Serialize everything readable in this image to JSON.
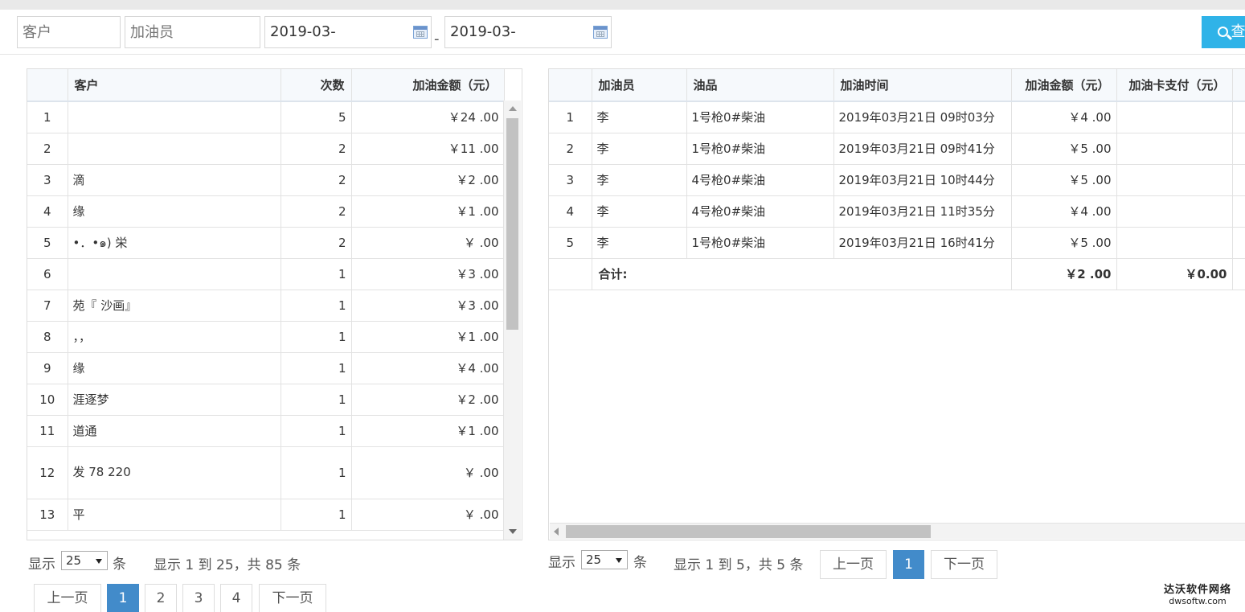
{
  "filters": {
    "customer_placeholder": "客户",
    "attendant_placeholder": "加油员",
    "date_from": "2019-03-",
    "date_to": "2019-03-",
    "separator": "-",
    "search_label": "查"
  },
  "left_table": {
    "columns": [
      "",
      "客户",
      "次数",
      "加油金额（元）"
    ],
    "rows": [
      {
        "index": "1",
        "customer": "",
        "count": "5",
        "amount": "￥24  .00"
      },
      {
        "index": "2",
        "customer": "",
        "count": "2",
        "amount": "￥11  .00"
      },
      {
        "index": "3",
        "customer": "滴",
        "count": "2",
        "amount": "￥2  .00"
      },
      {
        "index": "4",
        "customer": "缘",
        "count": "2",
        "amount": "￥1  .00"
      },
      {
        "index": "5",
        "customer": "•．•๑) 栄",
        "count": "2",
        "amount": "￥  .00"
      },
      {
        "index": "6",
        "customer": "",
        "count": "1",
        "amount": "￥3  .00"
      },
      {
        "index": "7",
        "customer": "苑『  沙画』",
        "count": "1",
        "amount": "￥3  .00"
      },
      {
        "index": "8",
        "customer": "，，",
        "count": "1",
        "amount": "￥1  .00"
      },
      {
        "index": "9",
        "customer": "缘",
        "count": "1",
        "amount": "￥4  .00"
      },
      {
        "index": "10",
        "customer": "涯逐梦",
        "count": "1",
        "amount": "￥2  .00"
      },
      {
        "index": "11",
        "customer": "道通",
        "count": "1",
        "amount": "￥1  .00"
      },
      {
        "index": "12",
        "customer": "发  78 220",
        "count": "1",
        "amount": "￥  .00"
      },
      {
        "index": "13",
        "customer": "平",
        "count": "1",
        "amount": "￥  .00"
      }
    ],
    "show_label": "显示",
    "page_size": "25",
    "unit_label": "条",
    "summary": "显示 1 到 25，共 85 条",
    "pages": [
      "上一页",
      "1",
      "2",
      "3",
      "4",
      "下一页"
    ],
    "active_page": "1"
  },
  "right_table": {
    "columns": [
      "",
      "加油员",
      "油品",
      "加油时间",
      "加油金额（元）",
      "加油卡支付（元）"
    ],
    "rows": [
      {
        "index": "1",
        "attendant": "李  ",
        "product": "1号枪0#柴油",
        "time": "2019年03月21日 09时03分",
        "amount": "￥4  .00",
        "card": ""
      },
      {
        "index": "2",
        "attendant": "李  ",
        "product": "1号枪0#柴油",
        "time": "2019年03月21日 09时41分",
        "amount": "￥5  .00",
        "card": ""
      },
      {
        "index": "3",
        "attendant": "李  ",
        "product": "4号枪0#柴油",
        "time": "2019年03月21日 10时44分",
        "amount": "￥5  .00",
        "card": ""
      },
      {
        "index": "4",
        "attendant": "李  ",
        "product": "4号枪0#柴油",
        "time": "2019年03月21日 11时35分",
        "amount": "￥4  .00",
        "card": ""
      },
      {
        "index": "5",
        "attendant": "李  ",
        "product": "1号枪0#柴油",
        "time": "2019年03月21日 16时41分",
        "amount": "￥5  .00",
        "card": ""
      }
    ],
    "total_label": "合计:",
    "total_amount": "￥2  .00",
    "total_card": "￥0.00",
    "show_label": "显示",
    "page_size": "25",
    "unit_label": "条",
    "summary": "显示 1 到 5，共 5 条",
    "prev": "上一页",
    "page": "1",
    "next": "下一页"
  },
  "watermark": {
    "line1": "达沃软件网络",
    "line2": "dwsoftw.com"
  }
}
